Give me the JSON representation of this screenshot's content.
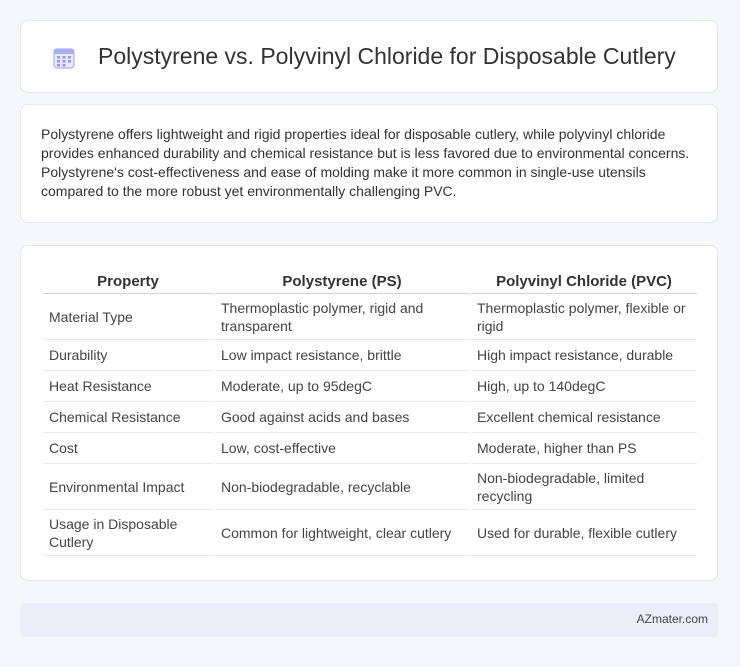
{
  "header": {
    "icon": "calendar-grid-icon",
    "title": "Polystyrene vs. Polyvinyl Chloride for Disposable Cutlery"
  },
  "intro": {
    "text": "Polystyrene offers lightweight and rigid properties ideal for disposable cutlery, while polyvinyl chloride provides enhanced durability and chemical resistance but is less favored due to environmental concerns. Polystyrene's cost-effectiveness and ease of molding make it more common in single-use utensils compared to the more robust yet environmentally challenging PVC."
  },
  "table": {
    "headers": [
      "Property",
      "Polystyrene (PS)",
      "Polyvinyl Chloride (PVC)"
    ],
    "rows": [
      [
        "Material Type",
        "Thermoplastic polymer, rigid and transparent",
        "Thermoplastic polymer, flexible or rigid"
      ],
      [
        "Durability",
        "Low impact resistance, brittle",
        "High impact resistance, durable"
      ],
      [
        "Heat Resistance",
        "Moderate, up to 95degC",
        "High, up to 140degC"
      ],
      [
        "Chemical Resistance",
        "Good against acids and bases",
        "Excellent chemical resistance"
      ],
      [
        "Cost",
        "Low, cost-effective",
        "Moderate, higher than PS"
      ],
      [
        "Environmental Impact",
        "Non-biodegradable, recyclable",
        "Non-biodegradable, limited recycling"
      ],
      [
        "Usage in Disposable Cutlery",
        "Common for lightweight, clear cutlery",
        "Used for durable, flexible cutlery"
      ]
    ]
  },
  "footer": {
    "text": "AZmater.com"
  },
  "colors": {
    "page_bg": "#f5f7fb",
    "card_bg": "#ffffff",
    "footer_bg": "#e9eef8",
    "icon_accent": "#8b8ff0"
  }
}
